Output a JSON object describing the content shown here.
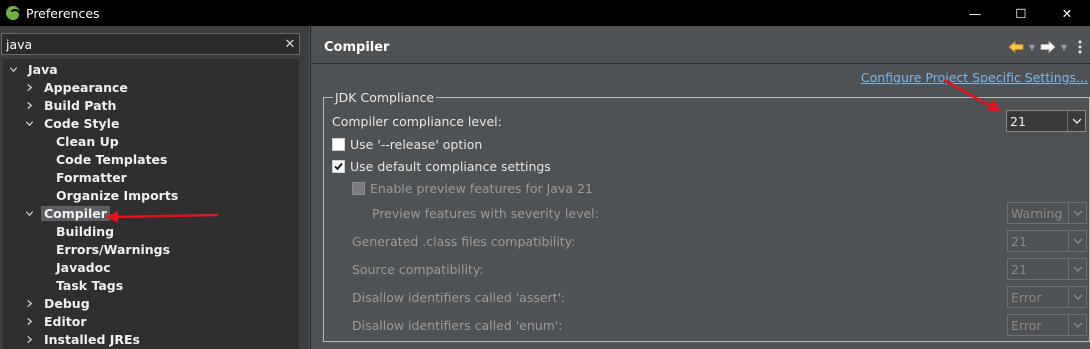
{
  "window": {
    "title": "Preferences",
    "minimize": "—",
    "maximize": "☐",
    "close": "✕"
  },
  "filter": {
    "value": "java",
    "clear": "✕"
  },
  "tree": [
    {
      "label": "Java",
      "depth": 0,
      "expanded": true
    },
    {
      "label": "Appearance",
      "depth": 1,
      "expanded": false
    },
    {
      "label": "Build Path",
      "depth": 1,
      "expanded": false
    },
    {
      "label": "Code Style",
      "depth": 1,
      "expanded": true
    },
    {
      "label": "Clean Up",
      "depth": 2,
      "leaf": true
    },
    {
      "label": "Code Templates",
      "depth": 2,
      "leaf": true
    },
    {
      "label": "Formatter",
      "depth": 2,
      "leaf": true
    },
    {
      "label": "Organize Imports",
      "depth": 2,
      "leaf": true
    },
    {
      "label": "Compiler",
      "depth": 1,
      "expanded": true,
      "selected": true
    },
    {
      "label": "Building",
      "depth": 2,
      "leaf": true
    },
    {
      "label": "Errors/Warnings",
      "depth": 2,
      "leaf": true
    },
    {
      "label": "Javadoc",
      "depth": 2,
      "leaf": true
    },
    {
      "label": "Task Tags",
      "depth": 2,
      "leaf": true
    },
    {
      "label": "Debug",
      "depth": 1,
      "expanded": false
    },
    {
      "label": "Editor",
      "depth": 1,
      "expanded": false
    },
    {
      "label": "Installed JREs",
      "depth": 1,
      "expanded": false
    }
  ],
  "page": {
    "title": "Compiler",
    "configure_link": "Configure Project Specific Settings...",
    "group_title": "JDK Compliance",
    "compliance_label": "Compiler compliance level:",
    "compliance_value": "21",
    "release_option_label": "Use '--release' option",
    "release_option_checked": false,
    "default_settings_label": "Use default compliance settings",
    "default_settings_checked": true,
    "preview_label": "Enable preview features for Java 21",
    "preview_checked": false,
    "preview_severity_label": "Preview features with severity level:",
    "preview_severity_value": "Warning",
    "class_compat_label": "Generated .class files compatibility:",
    "class_compat_value": "21",
    "source_compat_label": "Source compatibility:",
    "source_compat_value": "21",
    "assert_label": "Disallow identifiers called 'assert':",
    "assert_value": "Error",
    "enum_label": "Disallow identifiers called 'enum':",
    "enum_value": "Error"
  },
  "colors": {
    "annotation_arrow": "#e0141e",
    "link": "#7fb4e6",
    "nav_back": "#f2c14e"
  }
}
